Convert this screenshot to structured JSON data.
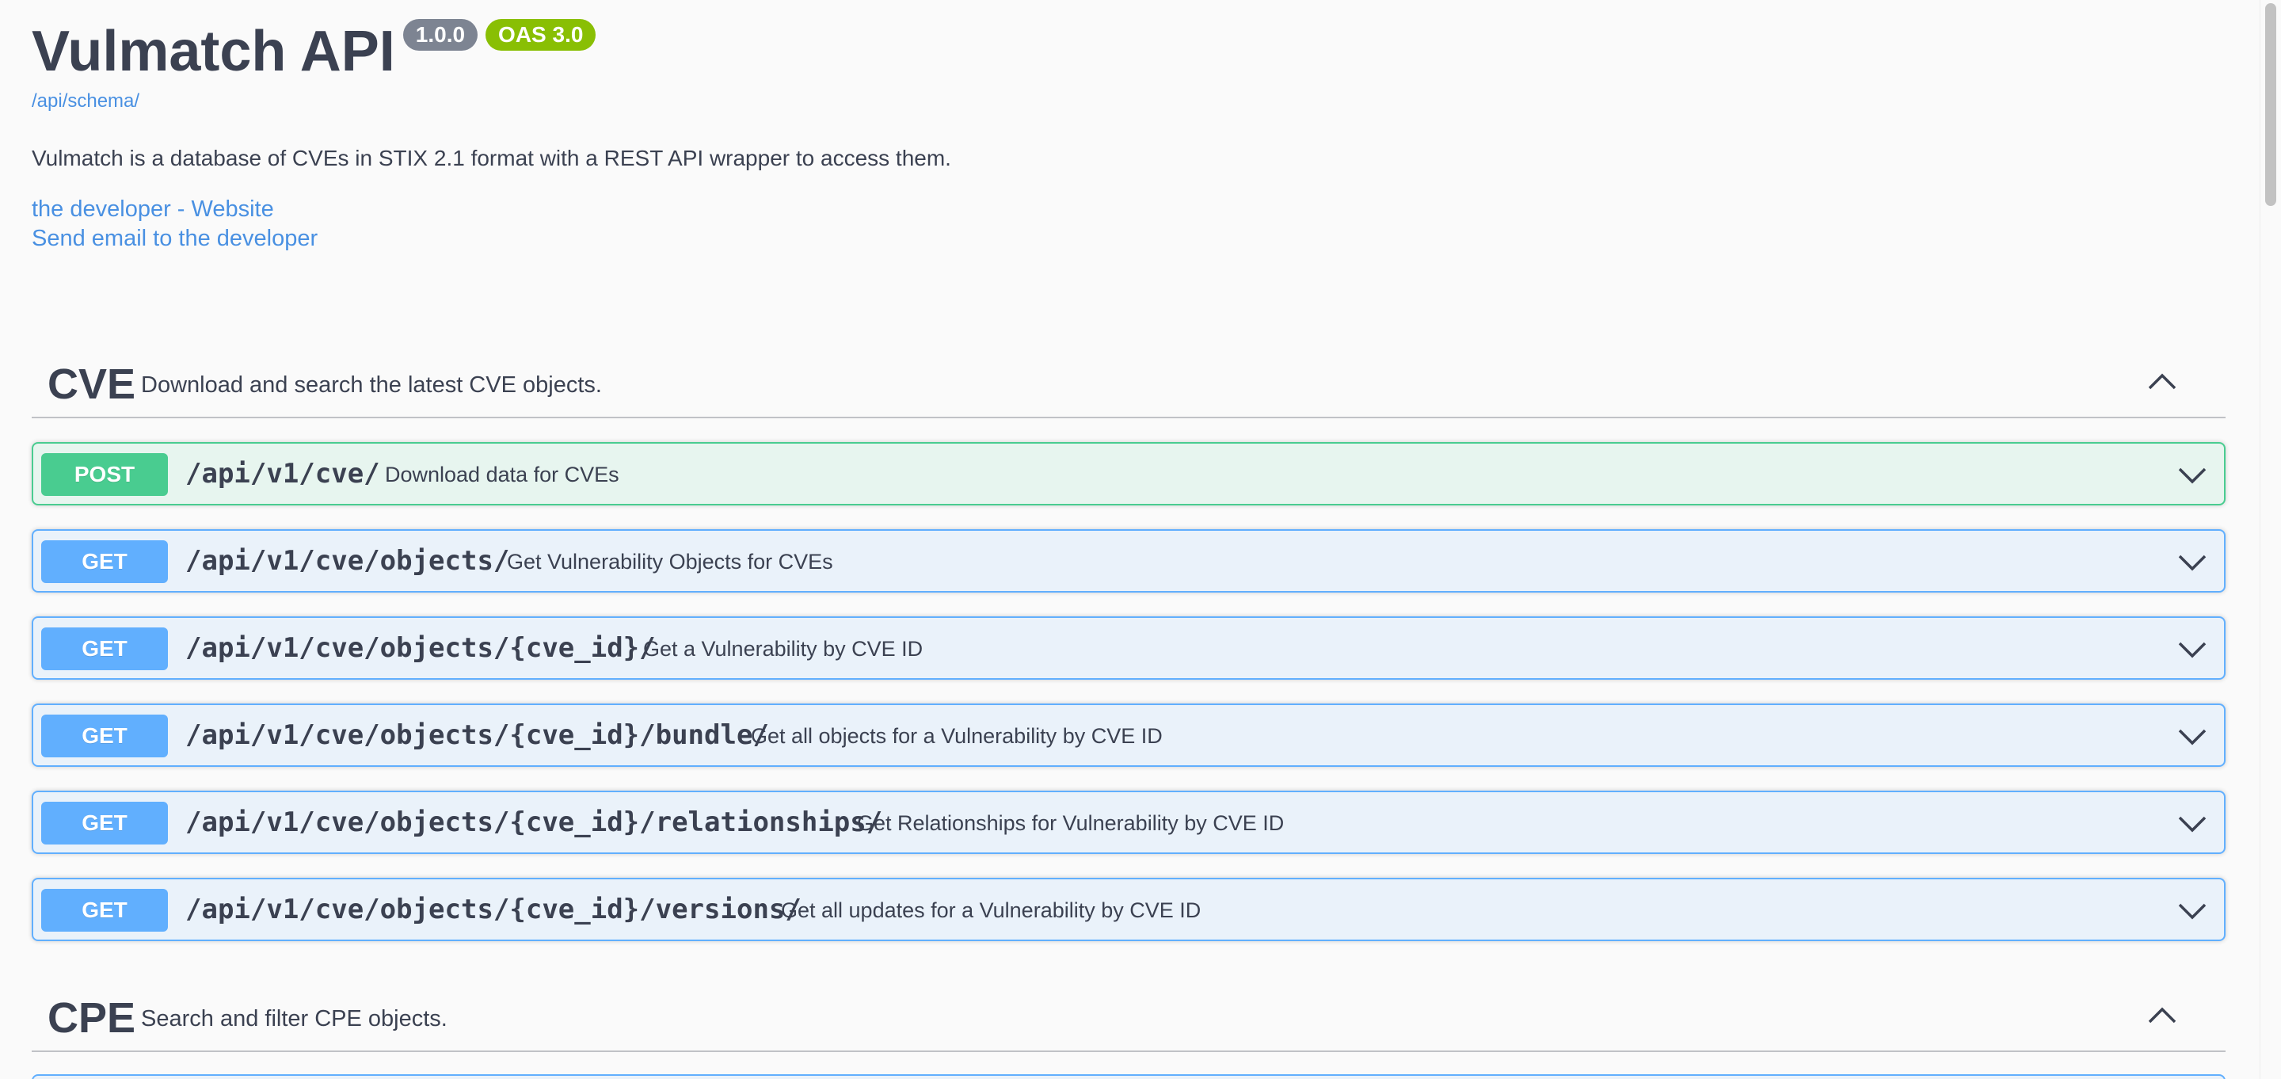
{
  "info": {
    "title": "Vulmatch API",
    "version": "1.0.0",
    "oas": "OAS 3.0",
    "schema_link": "/api/schema/",
    "description": "Vulmatch is a database of CVEs in STIX 2.1 format with a REST API wrapper to access them.",
    "contact_website": "the developer - Website",
    "contact_email": "Send email to the developer"
  },
  "colors": {
    "get": "#61affe",
    "post": "#49cc90",
    "version_badge": "#7d8492",
    "oas_badge": "#89bf04",
    "link": "#4990e2"
  },
  "tags": [
    {
      "name": "CVE",
      "description": "Download and search the latest CVE objects.",
      "expanded": true,
      "operations": [
        {
          "method": "POST",
          "path": "/api/v1/cve/",
          "summary": "Download data for CVEs"
        },
        {
          "method": "GET",
          "path": "/api/v1/cve/objects/",
          "summary": "Get Vulnerability Objects for CVEs"
        },
        {
          "method": "GET",
          "path": "/api/v1/cve/objects/{cve_id}/",
          "summary": "Get a Vulnerability by CVE ID"
        },
        {
          "method": "GET",
          "path": "/api/v1/cve/objects/{cve_id}/bundle/",
          "summary": "Get all objects for a Vulnerability by CVE ID"
        },
        {
          "method": "GET",
          "path": "/api/v1/cve/objects/{cve_id}/relationships/",
          "summary": "Get Relationships for Vulnerability by CVE ID"
        },
        {
          "method": "GET",
          "path": "/api/v1/cve/objects/{cve_id}/versions/",
          "summary": "Get all updates for a Vulnerability by CVE ID"
        }
      ]
    },
    {
      "name": "CPE",
      "description": "Search and filter CPE objects.",
      "expanded": true,
      "operations": []
    }
  ],
  "icons": {
    "tag_toggle": "chevron-up-icon",
    "op_toggle": "chevron-down-icon"
  }
}
